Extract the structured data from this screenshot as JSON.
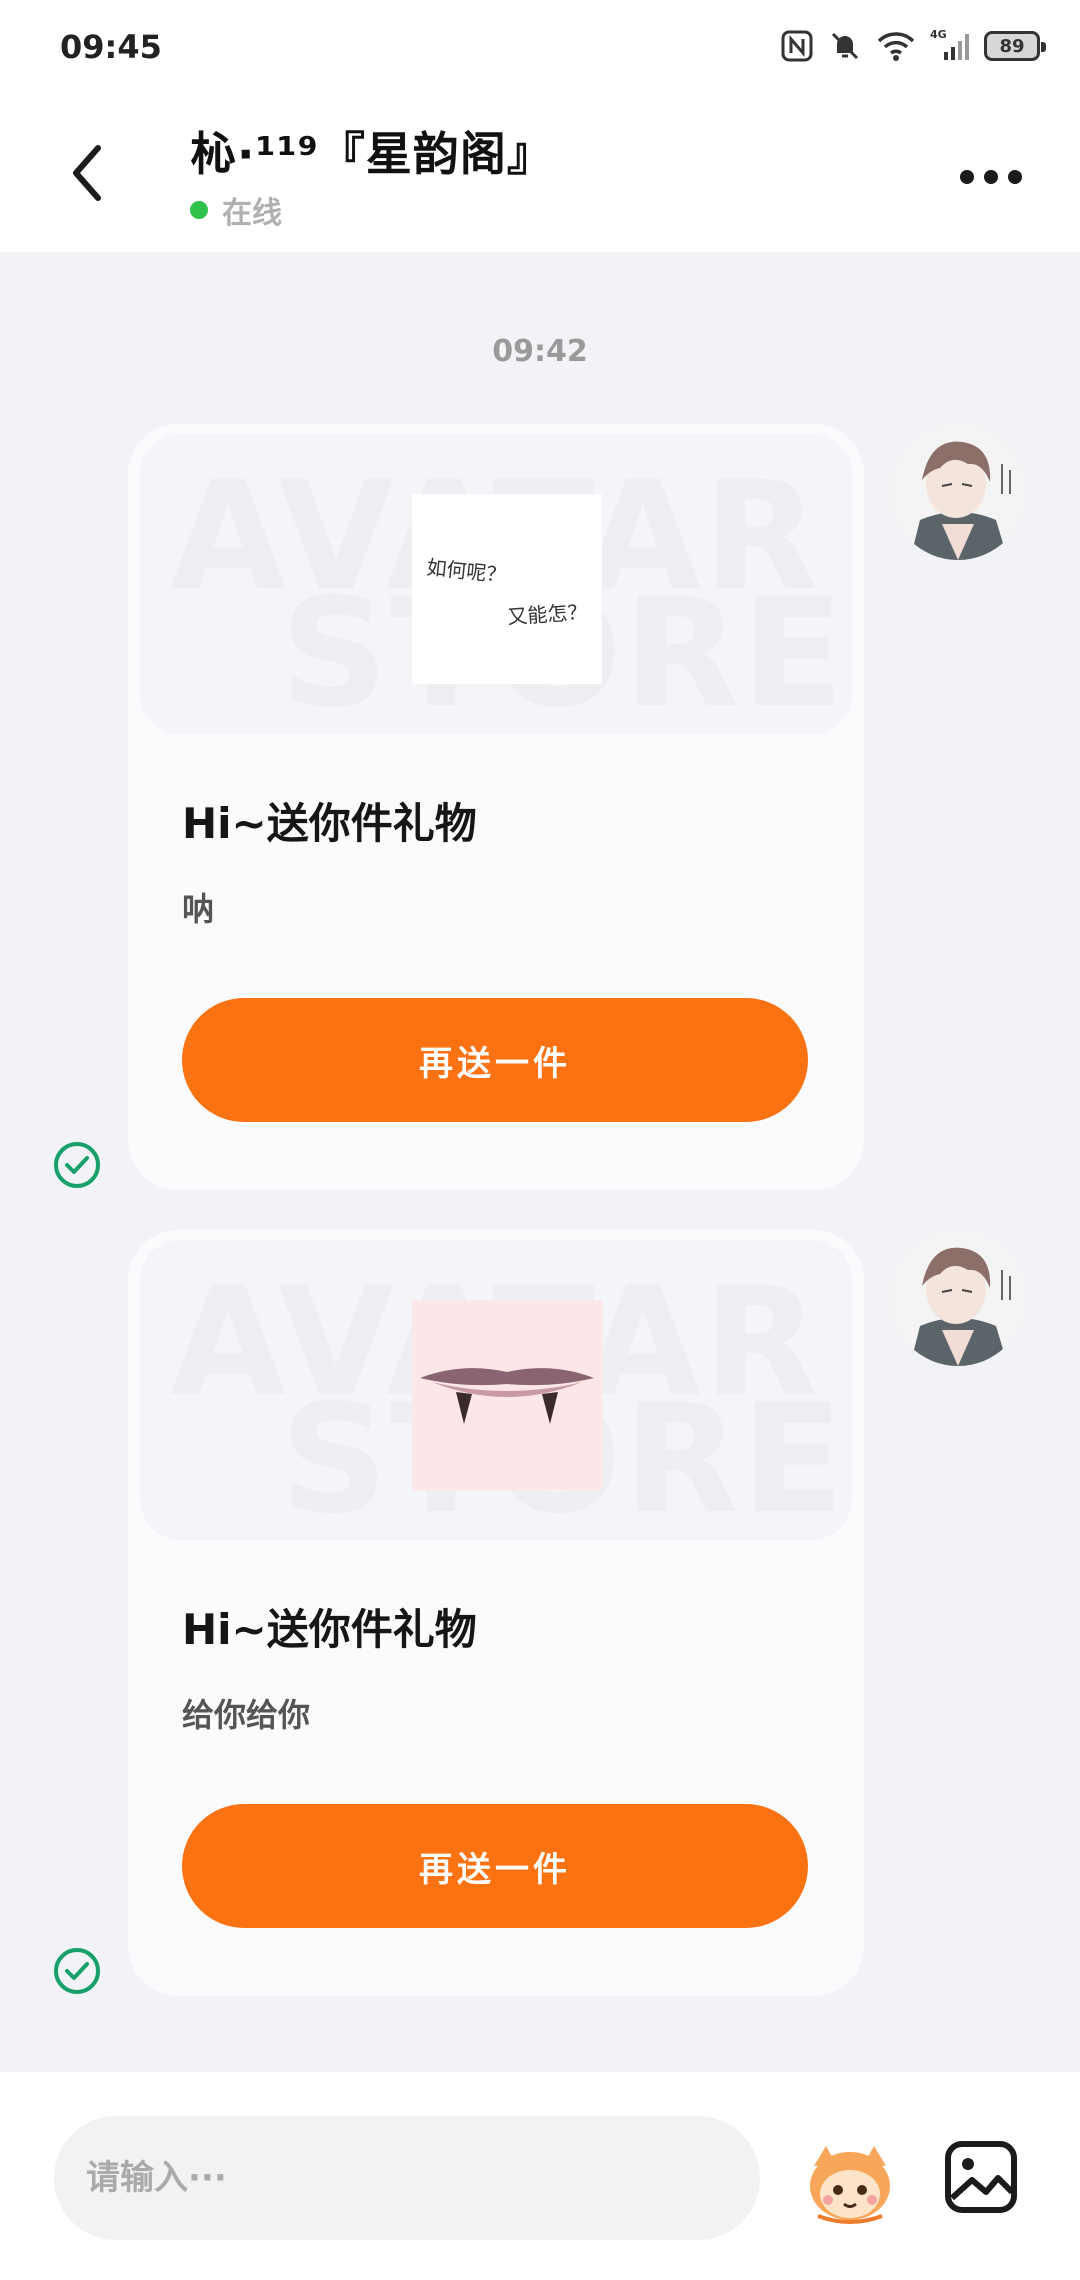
{
  "status_bar": {
    "time": "09:45",
    "network_label": "4G",
    "battery_level": "89"
  },
  "header": {
    "title": "杺·¹¹⁹『星韵阁』",
    "presence": "在线"
  },
  "conversation": {
    "timestamp": "09:42",
    "messages": [
      {
        "title": "Hi~送你件礼物",
        "text": "呐",
        "button_label": "再送一件",
        "image_caption_1": "如何呢？",
        "image_caption_2": "又能怎？"
      },
      {
        "title": "Hi~送你件礼物",
        "text": "给你给你",
        "button_label": "再送一件"
      }
    ],
    "watermark_line1": "AVATAR",
    "watermark_line2": "STORE"
  },
  "composer": {
    "placeholder": "请输入···"
  },
  "colors": {
    "accent": "#fb7212",
    "online": "#2fc24a",
    "sent_check": "#18a06a",
    "background": "#f2f3f7"
  },
  "icons": [
    "back-arrow-icon",
    "more-icon",
    "sent-check-icon",
    "mascot-icon",
    "image-icon",
    "nfc-icon",
    "mute-icon",
    "wifi-icon",
    "signal-icon",
    "battery-icon"
  ]
}
